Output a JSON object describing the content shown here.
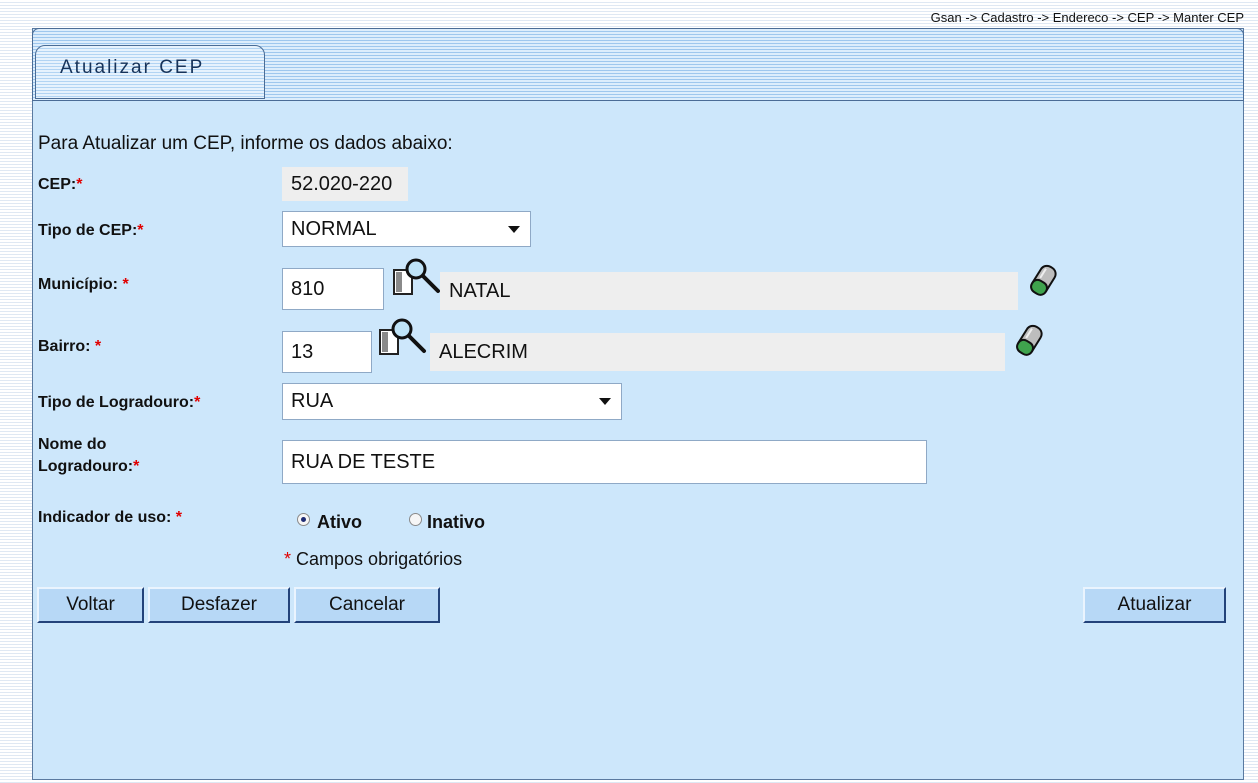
{
  "breadcrumb": "Gsan -> Cadastro -> Endereco -> CEP -> Manter CEP",
  "title": "Atualizar CEP",
  "instructions": "Para Atualizar um CEP, informe os dados abaixo:",
  "form": {
    "cep": {
      "label": "CEP:",
      "value": "52.020-220"
    },
    "tipo_cep": {
      "label": "Tipo de CEP:",
      "value": "NORMAL"
    },
    "municipio": {
      "label": "Município:",
      "code": "810",
      "name": "NATAL"
    },
    "bairro": {
      "label": "Bairro:",
      "code": "13",
      "name": "ALECRIM"
    },
    "tipo_logradouro": {
      "label": "Tipo de Logradouro:",
      "value": "RUA"
    },
    "nome_logradouro": {
      "label_line1": "Nome do",
      "label_line2": "Logradouro:",
      "value": "RUA DE TESTE"
    },
    "indicador_uso": {
      "label": "Indicador de uso:",
      "options": [
        "Ativo",
        "Inativo"
      ],
      "selected": "Ativo"
    }
  },
  "required_marker": "*",
  "required_note": "Campos obrigatórios",
  "buttons": {
    "voltar": "Voltar",
    "desfazer": "Desfazer",
    "cancelar": "Cancelar",
    "atualizar": "Atualizar"
  },
  "icons": {
    "search": "magnifier-document-icon",
    "clear": "eraser-icon"
  },
  "colors": {
    "panel": "#cde7fb",
    "required": "#e00000",
    "button": "#b7d8f6"
  }
}
